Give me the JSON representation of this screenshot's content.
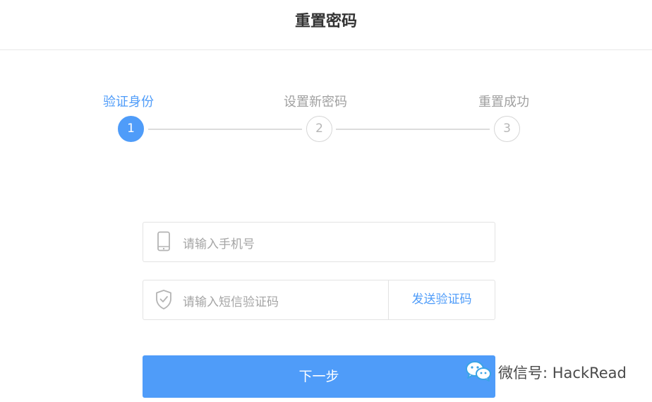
{
  "header": {
    "title": "重置密码"
  },
  "steps": [
    {
      "label": "验证身份",
      "number": "1",
      "active": true
    },
    {
      "label": "设置新密码",
      "number": "2",
      "active": false
    },
    {
      "label": "重置成功",
      "number": "3",
      "active": false
    }
  ],
  "form": {
    "phone": {
      "placeholder": "请输入手机号",
      "icon": "phone-icon"
    },
    "code": {
      "placeholder": "请输入短信验证码",
      "icon": "shield-check-icon",
      "send_label": "发送验证码"
    },
    "next_label": "下一步"
  },
  "watermark": {
    "text": "微信号: HackRead",
    "icon": "wechat-icon"
  },
  "colors": {
    "accent": "#4f9cf9",
    "inactive": "#b6b6b6",
    "line": "#dcdcdc"
  }
}
